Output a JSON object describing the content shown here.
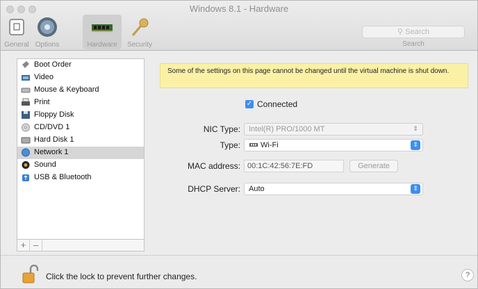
{
  "window": {
    "title": "Windows 8.1 - Hardware"
  },
  "toolbar": {
    "items": [
      {
        "label": "General",
        "icon": "general-icon"
      },
      {
        "label": "Options",
        "icon": "options-icon"
      },
      {
        "label": "Hardware",
        "icon": "hardware-icon",
        "selected": true
      },
      {
        "label": "Security",
        "icon": "key-icon"
      }
    ],
    "search_placeholder": "Search",
    "search_caption": "Search"
  },
  "sidebar": {
    "items": [
      {
        "label": "Boot Order",
        "icon": "boot-order-icon"
      },
      {
        "label": "Video",
        "icon": "video-icon"
      },
      {
        "label": "Mouse & Keyboard",
        "icon": "keyboard-icon"
      },
      {
        "label": "Print",
        "icon": "printer-icon"
      },
      {
        "label": "Floppy Disk",
        "icon": "floppy-icon"
      },
      {
        "label": "CD/DVD 1",
        "icon": "cd-icon"
      },
      {
        "label": "Hard Disk 1",
        "icon": "hard-disk-icon"
      },
      {
        "label": "Network 1",
        "icon": "network-icon",
        "selected": true
      },
      {
        "label": "Sound",
        "icon": "sound-icon"
      },
      {
        "label": "USB & Bluetooth",
        "icon": "usb-icon"
      }
    ],
    "footer": {
      "add": "+",
      "remove": "–"
    }
  },
  "banner": {
    "text": "Some of the settings on this page cannot be changed until the virtual machine is shut down."
  },
  "network": {
    "connected_label": "Connected",
    "connected": true,
    "nic_type_label": "NIC Type:",
    "nic_type_value": "Intel(R) PRO/1000 MT",
    "type_label": "Type:",
    "type_value": "Wi-Fi",
    "mac_label": "MAC address:",
    "mac_value": "00:1C:42:56:7E:FD",
    "generate_label": "Generate",
    "dhcp_label": "DHCP Server:",
    "dhcp_value": "Auto"
  },
  "footer": {
    "lock_text": "Click the lock to prevent further changes.",
    "help": "?"
  },
  "colors": {
    "accent": "#3d8ef2",
    "banner": "#fbf1a6",
    "selection": "#d6d6d6"
  }
}
